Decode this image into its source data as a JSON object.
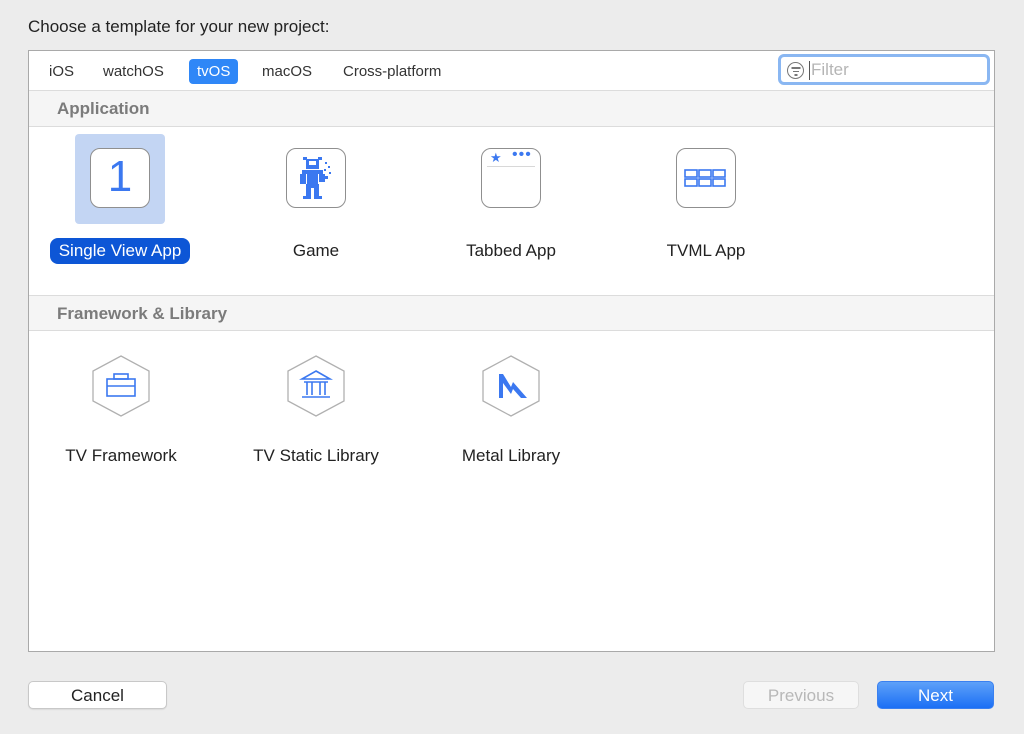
{
  "dialog": {
    "heading": "Choose a template for your new project:"
  },
  "platform_tabs": [
    {
      "label": "iOS",
      "active": false
    },
    {
      "label": "watchOS",
      "active": false
    },
    {
      "label": "tvOS",
      "active": true
    },
    {
      "label": "macOS",
      "active": false
    },
    {
      "label": "Cross-platform",
      "active": false
    }
  ],
  "filter": {
    "placeholder": "Filter",
    "value": "",
    "icon": "filter-icon"
  },
  "sections": [
    {
      "title": "Application",
      "templates": [
        {
          "label": "Single View App",
          "icon": "single-view-app-icon",
          "icon_text": "1",
          "selected": true
        },
        {
          "label": "Game",
          "icon": "game-robot-icon",
          "selected": false
        },
        {
          "label": "Tabbed App",
          "icon": "tabbed-app-icon",
          "selected": false
        },
        {
          "label": "TVML App",
          "icon": "tvml-grid-icon",
          "selected": false
        }
      ]
    },
    {
      "title": "Framework & Library",
      "templates": [
        {
          "label": "TV Framework",
          "icon": "toolbox-icon",
          "selected": false
        },
        {
          "label": "TV Static Library",
          "icon": "library-building-icon",
          "selected": false
        },
        {
          "label": "Metal Library",
          "icon": "metal-icon",
          "selected": false
        }
      ]
    }
  ],
  "buttons": {
    "cancel": "Cancel",
    "previous": "Previous",
    "previous_enabled": false,
    "next": "Next"
  },
  "colors": {
    "accent": "#2f87f7",
    "selection": "#0d56d6",
    "selection_bg": "#c3d5f3",
    "icon_blue": "#3b78f0"
  }
}
